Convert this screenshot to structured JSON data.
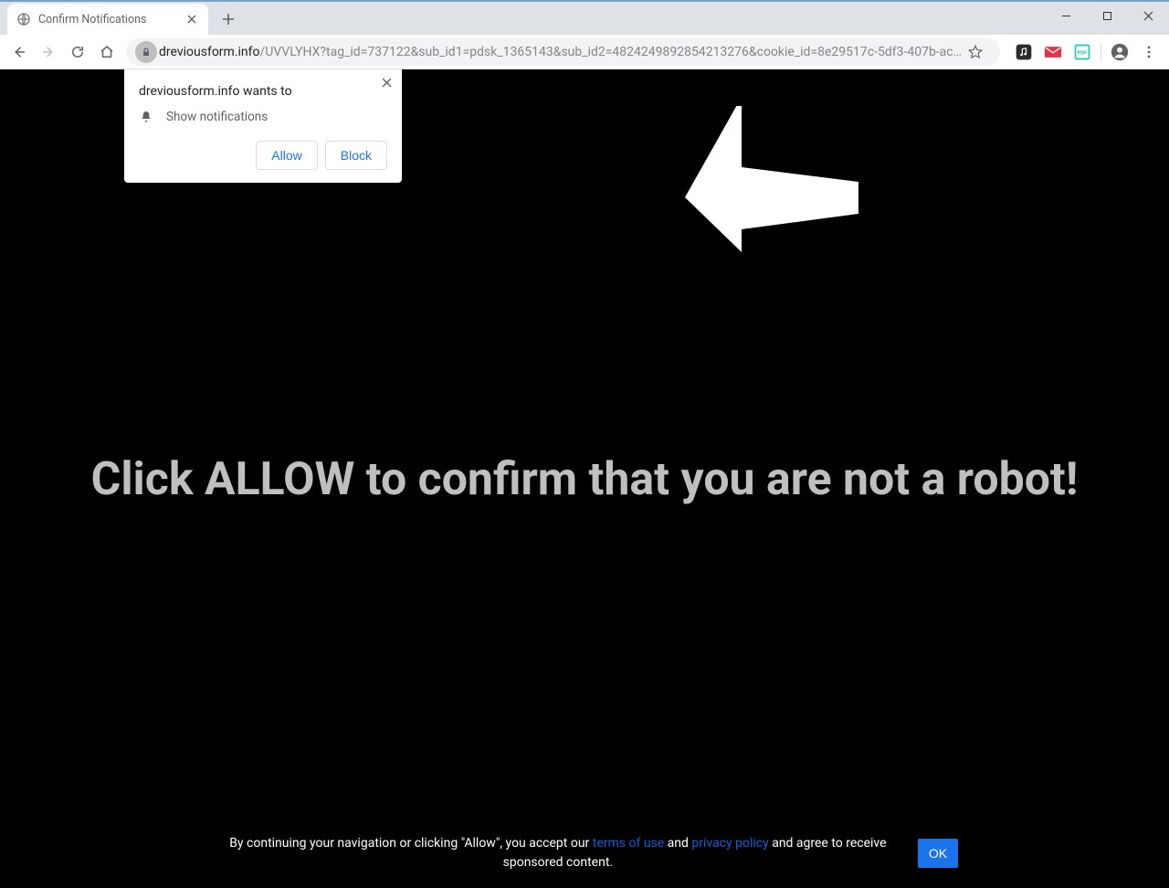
{
  "window": {
    "tab_title": "Confirm Notifications",
    "url_host": "dreviousform.info",
    "url_path": "/UVVLYHX?tag_id=737122&sub_id1=pdsk_1365143&sub_id2=4824249892854213276&cookie_id=8e29517c-5df3-407b-ac…"
  },
  "permission": {
    "title": "dreviousform.info wants to",
    "label": "Show notifications",
    "allow": "Allow",
    "block": "Block"
  },
  "page": {
    "headline": "Click ALLOW to confirm that you are not a robot!"
  },
  "consent": {
    "prefix": "By continuing your navigation or clicking \"Allow\", you accept our ",
    "terms": "terms of use",
    "and": " and ",
    "privacy": "privacy policy",
    "suffix": " and agree to receive sponsored content.",
    "ok": "OK"
  }
}
